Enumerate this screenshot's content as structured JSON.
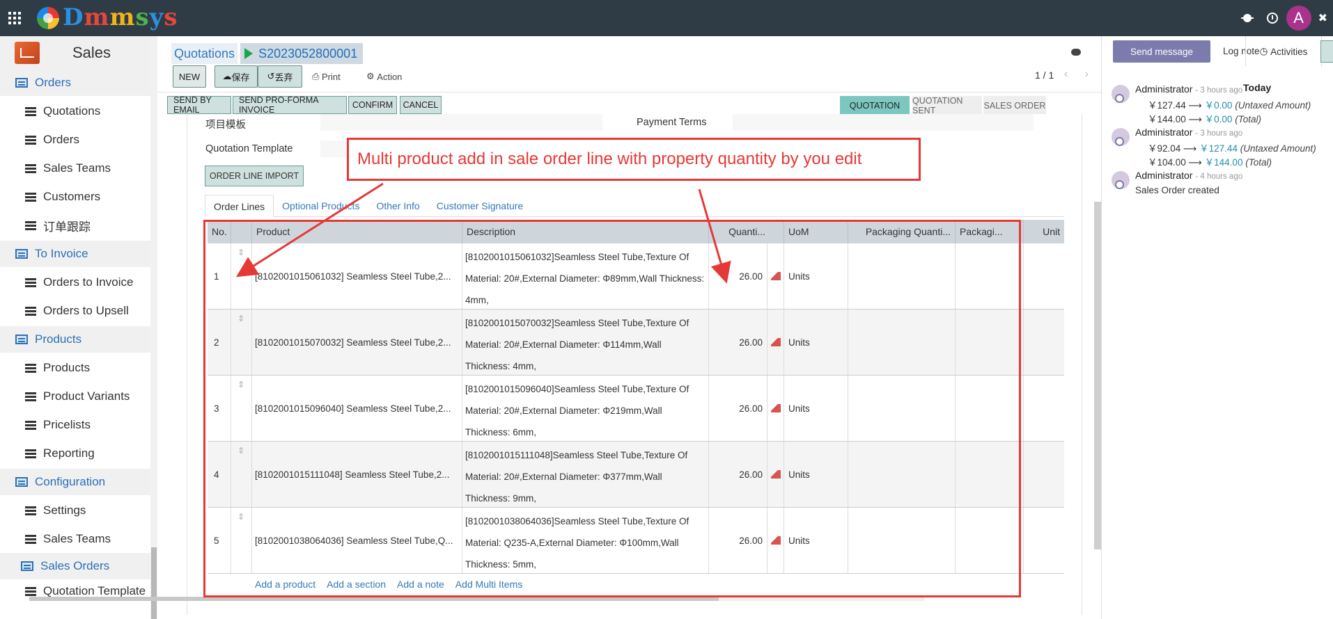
{
  "topbar": {
    "brand": [
      "D",
      "m",
      "m",
      "s",
      "y",
      "s"
    ],
    "avatar": "A"
  },
  "sidebar": {
    "title": "Sales",
    "items": [
      {
        "label": "Orders",
        "type": "section"
      },
      {
        "label": "Quotations",
        "type": "child"
      },
      {
        "label": "Orders",
        "type": "child"
      },
      {
        "label": "Sales Teams",
        "type": "child"
      },
      {
        "label": "Customers",
        "type": "child"
      },
      {
        "label": "订单跟踪",
        "type": "child"
      },
      {
        "label": "To Invoice",
        "type": "section"
      },
      {
        "label": "Orders to Invoice",
        "type": "child"
      },
      {
        "label": "Orders to Upsell",
        "type": "child"
      },
      {
        "label": "Products",
        "type": "section"
      },
      {
        "label": "Products",
        "type": "child"
      },
      {
        "label": "Product Variants",
        "type": "child"
      },
      {
        "label": "Pricelists",
        "type": "child"
      },
      {
        "label": "Reporting",
        "type": "child"
      },
      {
        "label": "Configuration",
        "type": "section"
      },
      {
        "label": "Settings",
        "type": "child"
      },
      {
        "label": "Sales Teams",
        "type": "child"
      },
      {
        "label": "Sales Orders",
        "type": "active"
      },
      {
        "label": "Quotation Template",
        "type": "child"
      }
    ]
  },
  "breadcrumb": {
    "parent": "Quotations",
    "current": "S2023052800001"
  },
  "toolbar": {
    "new": "NEW",
    "save": "保存",
    "discard": "丢弃",
    "print": "Print",
    "action": "Action",
    "pager": "1 / 1",
    "pager_nav": "‹ ›"
  },
  "status_buttons": [
    "SEND BY EMAIL",
    "SEND PRO-FORMA INVOICE",
    "CONFIRM",
    "CANCEL"
  ],
  "stages": [
    {
      "label": "QUOTATION",
      "active": true
    },
    {
      "label": "QUOTATION SENT",
      "active": false
    },
    {
      "label": "SALES ORDER",
      "active": false
    }
  ],
  "form": {
    "project_template_label": "项目模板",
    "payment_terms_label": "Payment Terms",
    "quotation_template_label": "Quotation Template",
    "import_button": "ORDER LINE IMPORT"
  },
  "tabs": [
    "Order Lines",
    "Optional Products",
    "Other Info",
    "Customer Signature"
  ],
  "table": {
    "headers": {
      "no": "No.",
      "product": "Product",
      "description": "Description",
      "quantity": "Quanti...",
      "uom": "UoM",
      "packaging_qty": "Packaging Quanti...",
      "packaging": "Packagi...",
      "unit": "Unit"
    },
    "rows": [
      {
        "no": "1",
        "product": "[8102001015061032] Seamless Steel Tube,2...",
        "description": "[8102001015061032]Seamless Steel Tube,Texture Of Material: 20#,External Diameter: Φ89mm,Wall Thickness: 4mm,",
        "quantity": "26.00",
        "uom": "Units"
      },
      {
        "no": "2",
        "product": "[8102001015070032] Seamless Steel Tube,2...",
        "description": "[8102001015070032]Seamless Steel Tube,Texture Of Material: 20#,External Diameter: Φ114mm,Wall Thickness: 4mm,",
        "quantity": "26.00",
        "uom": "Units"
      },
      {
        "no": "3",
        "product": "[8102001015096040] Seamless Steel Tube,2...",
        "description": "[8102001015096040]Seamless Steel Tube,Texture Of Material: 20#,External Diameter: Φ219mm,Wall Thickness: 6mm,",
        "quantity": "26.00",
        "uom": "Units"
      },
      {
        "no": "4",
        "product": "[8102001015111048] Seamless Steel Tube,2...",
        "description": "[8102001015111048]Seamless Steel Tube,Texture Of Material: 20#,External Diameter: Φ377mm,Wall Thickness: 9mm,",
        "quantity": "26.00",
        "uom": "Units"
      },
      {
        "no": "5",
        "product": "[8102001038064036] Seamless Steel Tube,Q...",
        "description": "[8102001038064036]Seamless Steel Tube,Texture Of Material: Q235-A,External Diameter: Φ100mm,Wall Thickness: 5mm,",
        "quantity": "26.00",
        "uom": "Units"
      }
    ],
    "add_links": [
      "Add a product",
      "Add a section",
      "Add a note",
      "Add Multi Items"
    ]
  },
  "annotation": {
    "text": "Multi product add in sale order line with property quantity by you edit",
    "color": "#e53935"
  },
  "chatter": {
    "send_message": "Send message",
    "log_note": "Log note",
    "activities": "Activities",
    "today": "Today",
    "messages": [
      {
        "author": "Administrator",
        "time": "- 3 hours ago",
        "lines": [
          {
            "old": "￥127.44",
            "new": "￥0.00",
            "field": "(Untaxed Amount)"
          },
          {
            "old": "￥144.00",
            "new": "￥0.00",
            "field": "(Total)"
          }
        ]
      },
      {
        "author": "Administrator",
        "time": "- 3 hours ago",
        "lines": [
          {
            "old": "￥92.04",
            "new": "￥127.44",
            "field": "(Untaxed Amount)"
          },
          {
            "old": "￥104.00",
            "new": "￥144.00",
            "field": "(Total)"
          }
        ]
      },
      {
        "author": "Administrator",
        "time": "- 4 hours ago",
        "body": "Sales Order created"
      }
    ]
  }
}
